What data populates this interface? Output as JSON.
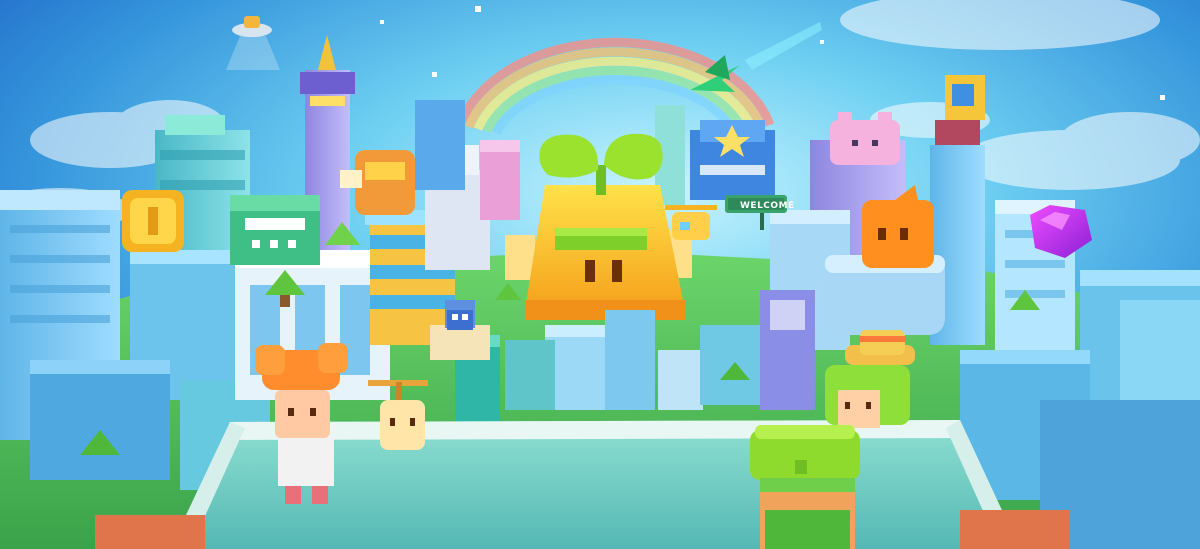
{
  "scene": {
    "type": "voxel-city-key-art",
    "welcome_sign": {
      "text": "WELCOME"
    },
    "colors": {
      "sky_top": "#1f6fd0",
      "sky_mid": "#4fb3e8",
      "sky_glow": "#bdf0ff",
      "plaza_floor": "#7ad3c7",
      "grass": "#5fc24a",
      "sprout_green": "#9be22c",
      "sprout_yellow": "#f9c21b",
      "rainbow": [
        "#ff6b6b",
        "#ffb347",
        "#ffe66d",
        "#8be38b",
        "#6ecbff",
        "#b48cff"
      ]
    },
    "icons": [
      "sprout-building-icon",
      "rainbow-icon",
      "gold-coin-icon",
      "purple-gem-icon",
      "paper-plane-icon",
      "ufo-icon",
      "orange-cat-icon",
      "pink-bear-icon",
      "yellow-trophy-icon",
      "helicopter-icon",
      "welcome-sign-icon"
    ],
    "characters": [
      "orange-hair-character",
      "propeller-toy-character",
      "straw-hat-character",
      "sprout-hat-character",
      "small-robot-character",
      "pilot-character"
    ]
  }
}
